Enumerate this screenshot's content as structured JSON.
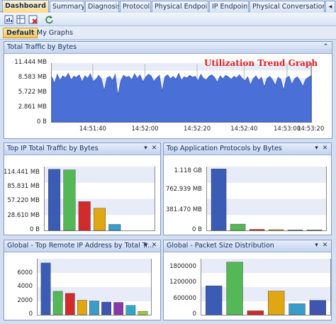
{
  "tabs": [
    {
      "label": "Dashboard",
      "active": true
    },
    {
      "label": "Summary"
    },
    {
      "label": "Diagnosis"
    },
    {
      "label": "Protocol"
    },
    {
      "label": "Physical Endpoint"
    },
    {
      "label": "IP Endpoint"
    },
    {
      "label": "Physical Conversation"
    }
  ],
  "toolbar": {
    "icons": [
      "new-graph-icon",
      "edit-graph-icon",
      "delete-graph-icon",
      "refresh-icon"
    ]
  },
  "graph_tabs": [
    {
      "label": "Default",
      "active": true
    },
    {
      "label": "My Graphs"
    }
  ],
  "colors": {
    "area_fill": "#4a6fd6",
    "bar_colors": [
      "#3b5cb5",
      "#54b856",
      "#d22b2b",
      "#e0a712",
      "#3a9cc8",
      "#3f55b0",
      "#8a3aa8",
      "#2ea8c9",
      "#9dcb3a"
    ]
  },
  "panels": {
    "total_traffic": {
      "title": "Total Traffic by Bytes",
      "annotation": "Utilization Trend Graph"
    },
    "top_ip": {
      "title": "Top IP Total Traffic by Bytes"
    },
    "top_apps": {
      "title": "Top Application Protocols by Bytes"
    },
    "remote_ip": {
      "title": "Global - Top Remote IP Address by Total Tr..."
    },
    "packet_size": {
      "title": "Global - Packet Size Distribution"
    }
  },
  "chart_data": [
    {
      "type": "area",
      "title": "Total Traffic by Bytes",
      "ylim": [
        0,
        11.444
      ],
      "y_ticks": [
        "0 B",
        "2.861 MB",
        "5.722 MB",
        "8.583 MB",
        "11.444 MB"
      ],
      "x_ticks": [
        "14:51:40",
        "14:52:00",
        "14:52:20",
        "14:52:40",
        "14:53:00",
        "14:53:20"
      ],
      "y_unit": "MB",
      "values": [
        8.9,
        7.6,
        9.4,
        8.2,
        9.1,
        8.7,
        9.6,
        8.3,
        9.0,
        8.8,
        9.3,
        7.9,
        9.1,
        8.6,
        9.5,
        8.0,
        8.4,
        9.2,
        8.5,
        6.2,
        8.7,
        9.0,
        8.2,
        9.4,
        5.3,
        8.1,
        9.2,
        8.8,
        9.0,
        8.3,
        9.5,
        8.6,
        9.3,
        7.9,
        8.8,
        9.4,
        9.1,
        8.0,
        8.7,
        9.2,
        6.1,
        8.9,
        9.3,
        8.5,
        9.0,
        8.4,
        9.6,
        8.2,
        8.9,
        8.7,
        9.2,
        8.8,
        9.0,
        8.1,
        9.4,
        8.6,
        8.3,
        9.0,
        9.3,
        8.8,
        7.8,
        9.1,
        8.5,
        9.2,
        8.9,
        8.4,
        9.0,
        8.7,
        9.3,
        8.6,
        8.1,
        8.9,
        7.3,
        8.5,
        9.1,
        8.2,
        8.8,
        6.9,
        8.6,
        9.0,
        8.3,
        7.2,
        8.8,
        8.4,
        6.3,
        8.7,
        9.0,
        7.4,
        8.5,
        8.9,
        8.1,
        7.0,
        8.4,
        8.8,
        9.1
      ]
    },
    {
      "type": "bar",
      "title": "Top IP Total Traffic by Bytes",
      "ylim": [
        0,
        125
      ],
      "y_ticks": [
        "0 B",
        "28.610 MB",
        "57.220 MB",
        "85.831 MB",
        "114.441 MB"
      ],
      "values": [
        121,
        120,
        57,
        44,
        12
      ]
    },
    {
      "type": "bar",
      "title": "Top Application Protocols by Bytes",
      "ylim": [
        0,
        1.2
      ],
      "y_ticks": [
        "0 B",
        "381.470 MB",
        "762.939 MB",
        "1.118 GB"
      ],
      "values": [
        1.17,
        0.12,
        0.02,
        0.015,
        0.01,
        0.008
      ]
    },
    {
      "type": "bar",
      "title": "Global - Top Remote IP Address by Total Tr...",
      "ylim": [
        0,
        8000
      ],
      "y_ticks": [
        "0",
        "2000",
        "4000",
        "6000"
      ],
      "values": [
        7500,
        3400,
        3100,
        2100,
        2000,
        1850,
        1800,
        1350,
        500
      ]
    },
    {
      "type": "bar",
      "title": "Global - Packet Size Distribution",
      "ylim": [
        0,
        2100000
      ],
      "y_ticks": [
        "0",
        "600000",
        "1200000",
        "1800000"
      ],
      "values": [
        1100000,
        2000000,
        150000,
        900000,
        420000,
        550000
      ]
    }
  ]
}
